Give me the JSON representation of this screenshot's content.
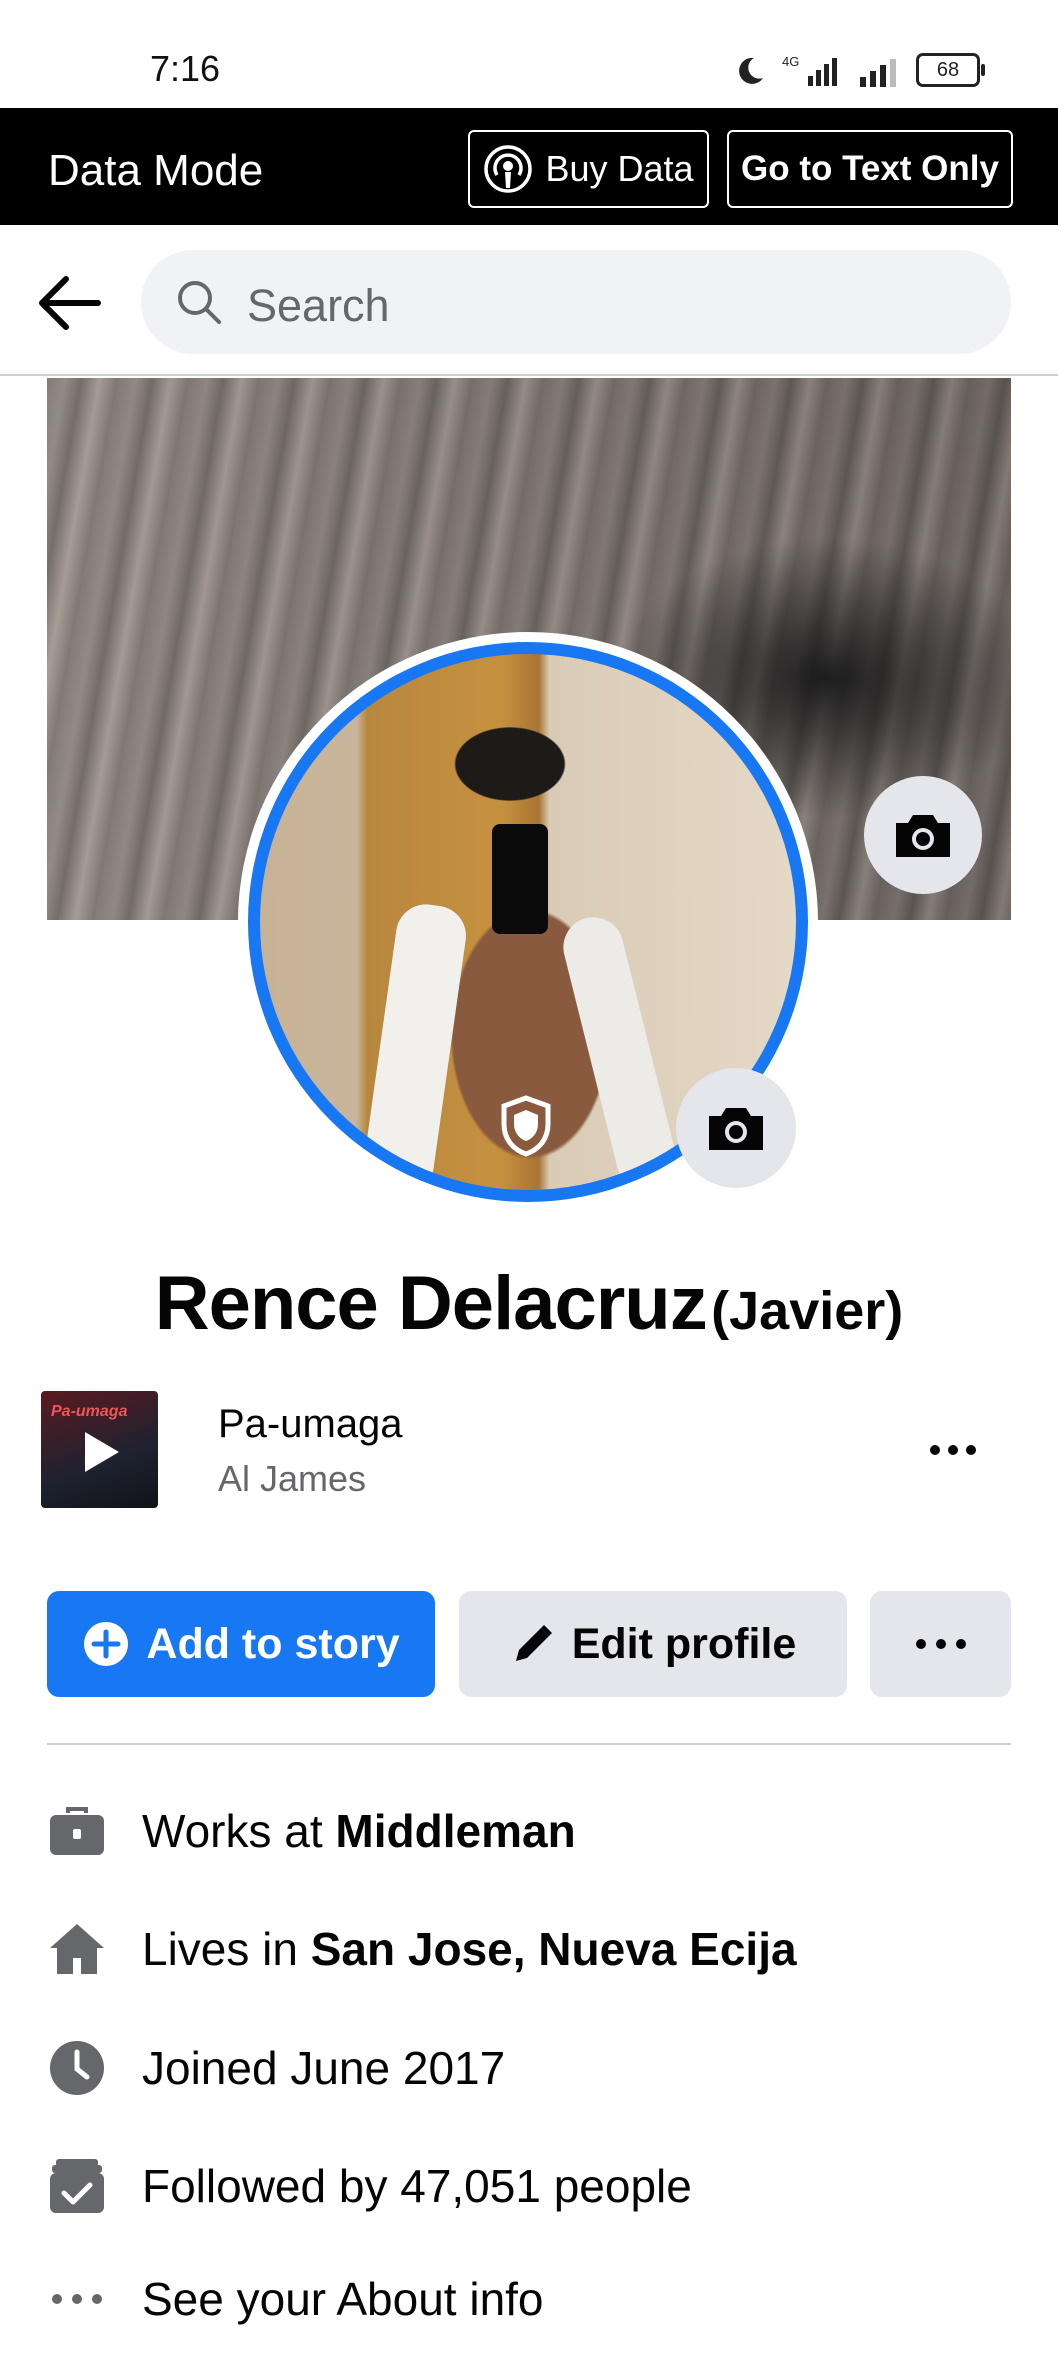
{
  "status_bar": {
    "time": "7:16",
    "network": "4G",
    "battery": "68"
  },
  "data_mode_bar": {
    "title": "Data Mode",
    "buy_data_label": "Buy Data",
    "text_only_label": "Go to Text Only"
  },
  "search": {
    "placeholder": "Search"
  },
  "profile": {
    "name": "Rence Delacruz",
    "alternate_name": "(Javier)"
  },
  "song": {
    "title": "Pa-umaga",
    "artist": "Al James",
    "art_text": "Pa-umaga"
  },
  "actions": {
    "add_story_label": "Add to story",
    "edit_profile_label": "Edit profile"
  },
  "details": {
    "work_prefix": "Works at ",
    "work_place": "Middleman",
    "lives_prefix": "Lives in ",
    "lives_place": "San Jose, Nueva Ecija",
    "joined": "Joined June 2017",
    "followers": "Followed by 47,051 people",
    "about": "See your About info"
  },
  "colors": {
    "accent": "#1877f2",
    "button_gray": "#e4e6eb",
    "icon_gray": "#65676b",
    "text": "#050505"
  }
}
